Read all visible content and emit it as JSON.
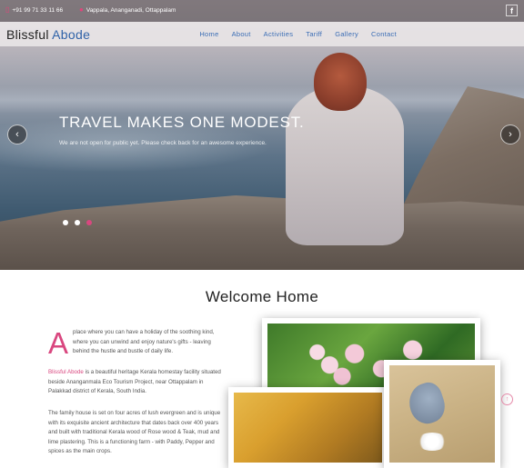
{
  "topbar": {
    "phone": "+91 99 71 33 11 66",
    "address": "Vappala, Ananganadi, Ottappalam",
    "social": "f"
  },
  "brand": {
    "part1": "Blissful",
    "part2": "Abode"
  },
  "nav": [
    "Home",
    "About",
    "Activities",
    "Tariff",
    "Gallery",
    "Contact"
  ],
  "hero": {
    "title": "TRAVEL MAKES ONE MODEST.",
    "subtitle": "We are not open for public yet. Please check back for an awesome experience.",
    "prev": "‹",
    "next": "›",
    "slides": 3,
    "active_slide": 3
  },
  "welcome": {
    "heading": "Welcome Home",
    "dropcap": "A",
    "intro": "place where you can have a holiday of the soothing kind, where you can unwind and enjoy nature's gifts - leaving behind the hustle and bustle of daily life.",
    "p1_highlight": "Blissful Abode",
    "p1_rest": " is a beautiful heritage Kerala homestay facility situated beside Ananganmala Eco Tourism Project, near Ottappalam in Palakkad district of Kerala, South India.",
    "p2": "The family house is set on four acres of lush evergreen and is unique with its exquisite ancient architecture that dates back over 400 years and built with traditional Kerala wood of Rose wood & Teak, mud and lime plastering. This is a functioning farm - with Paddy, Pepper and spices as the main crops."
  },
  "colors": {
    "accent": "#d9477f",
    "nav": "#3a6db5"
  },
  "scroll_top_icon": "arrow-up-icon"
}
